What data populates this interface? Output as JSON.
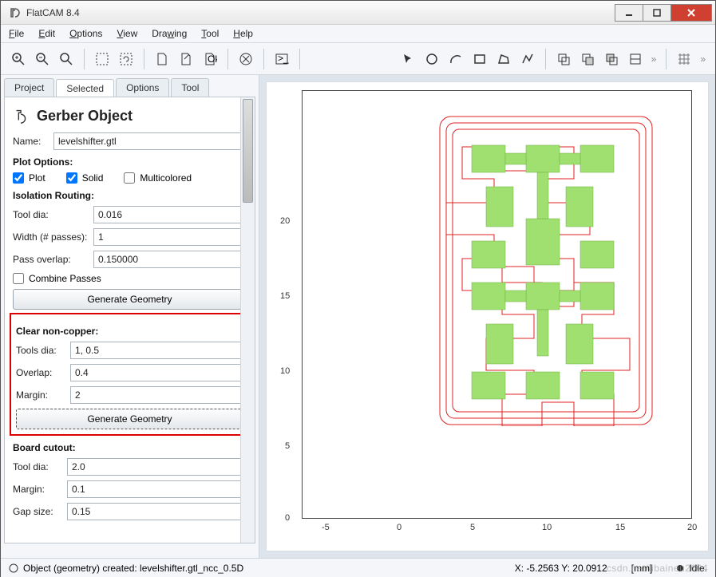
{
  "window": {
    "title": "FlatCAM 8.4"
  },
  "menu": {
    "file": "File",
    "edit": "Edit",
    "options": "Options",
    "view": "View",
    "drawing": "Drawing",
    "tool": "Tool",
    "help": "Help"
  },
  "tabs": {
    "project": "Project",
    "selected": "Selected",
    "options": "Options",
    "tool": "Tool"
  },
  "panel": {
    "heading": "Gerber Object",
    "name_label": "Name:",
    "name_value": "levelshifter.gtl",
    "plot_options_hdr": "Plot Options:",
    "plot_chk": "Plot",
    "solid_chk": "Solid",
    "multi_chk": "Multicolored",
    "isolation_hdr": "Isolation Routing:",
    "tool_dia_label": "Tool dia:",
    "tool_dia_val": "0.016",
    "width_label": "Width (# passes):",
    "width_val": "1",
    "pass_overlap_label": "Pass overlap:",
    "pass_overlap_val": "0.150000",
    "combine_chk": "Combine Passes",
    "gen_geom_btn": "Generate Geometry",
    "clear_hdr": "Clear non-copper:",
    "tools_dia_label": "Tools dia:",
    "tools_dia_val": "1, 0.5",
    "overlap_label": "Overlap:",
    "overlap_val": "0.4",
    "margin_label": "Margin:",
    "margin_val": "2",
    "gen_geom_btn2": "Generate Geometry",
    "board_cutout_hdr": "Board cutout:",
    "bc_tool_dia_label": "Tool dia:",
    "bc_tool_dia_val": "2.0",
    "bc_margin_label": "Margin:",
    "bc_margin_val": "0.1",
    "bc_gap_label": "Gap size:",
    "bc_gap_val": "0.15"
  },
  "status": {
    "obj_created": "Object (geometry) created: levelshifter.gtl_ncc_0.5D",
    "coords": "X: -5.2563   Y: 20.0912",
    "units": "[mm]",
    "idle": "Idle."
  },
  "axis": {
    "y": [
      "0",
      "5",
      "10",
      "15",
      "20"
    ],
    "x": [
      "-5",
      "0",
      "5",
      "10",
      "15",
      "20"
    ]
  },
  "colors": {
    "copper": "#a0e070",
    "outline": "#e02020"
  },
  "watermark": "csdn.net/libaineu2004"
}
